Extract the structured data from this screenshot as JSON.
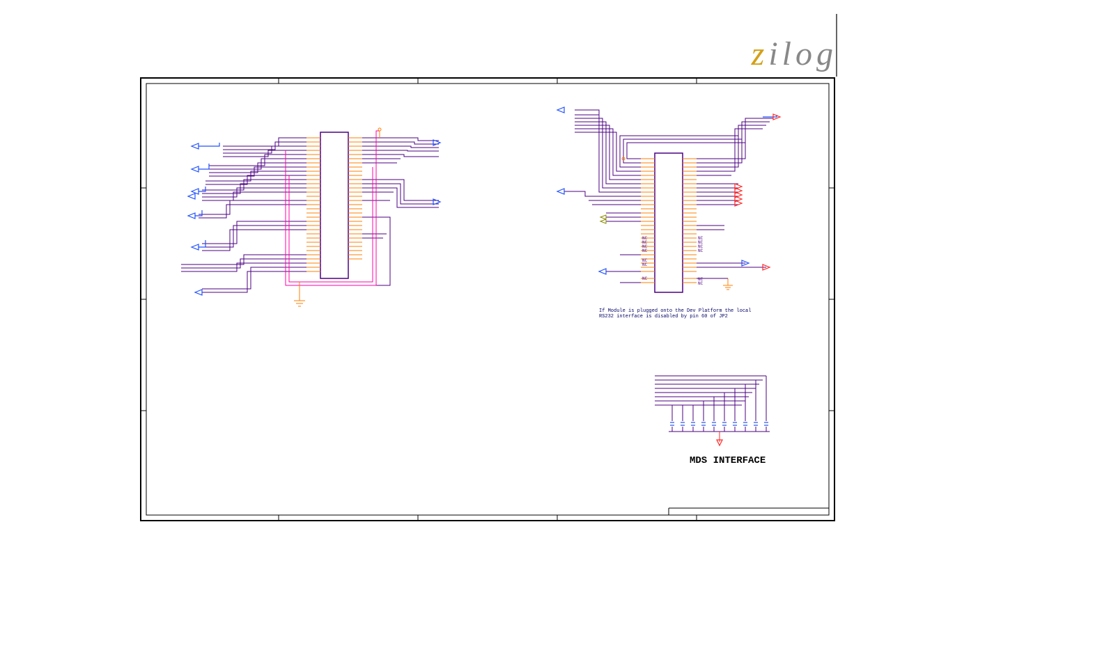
{
  "logo": {
    "z": "z",
    "rest": "ilog"
  },
  "note_line1": "If Module is plugged onto the Dev Platform the local",
  "note_line2": "RS232 interface is disabled by pin 60 of JP2",
  "mds_label": "MDS INTERFACE",
  "nc_label": "NC",
  "blocks": {
    "left_chip": {
      "desc": "Left schematic IC block with pin nets"
    },
    "right_chip": {
      "desc": "Right schematic IC connector block JP2"
    },
    "mds": {
      "desc": "MDS interface connector area"
    }
  }
}
